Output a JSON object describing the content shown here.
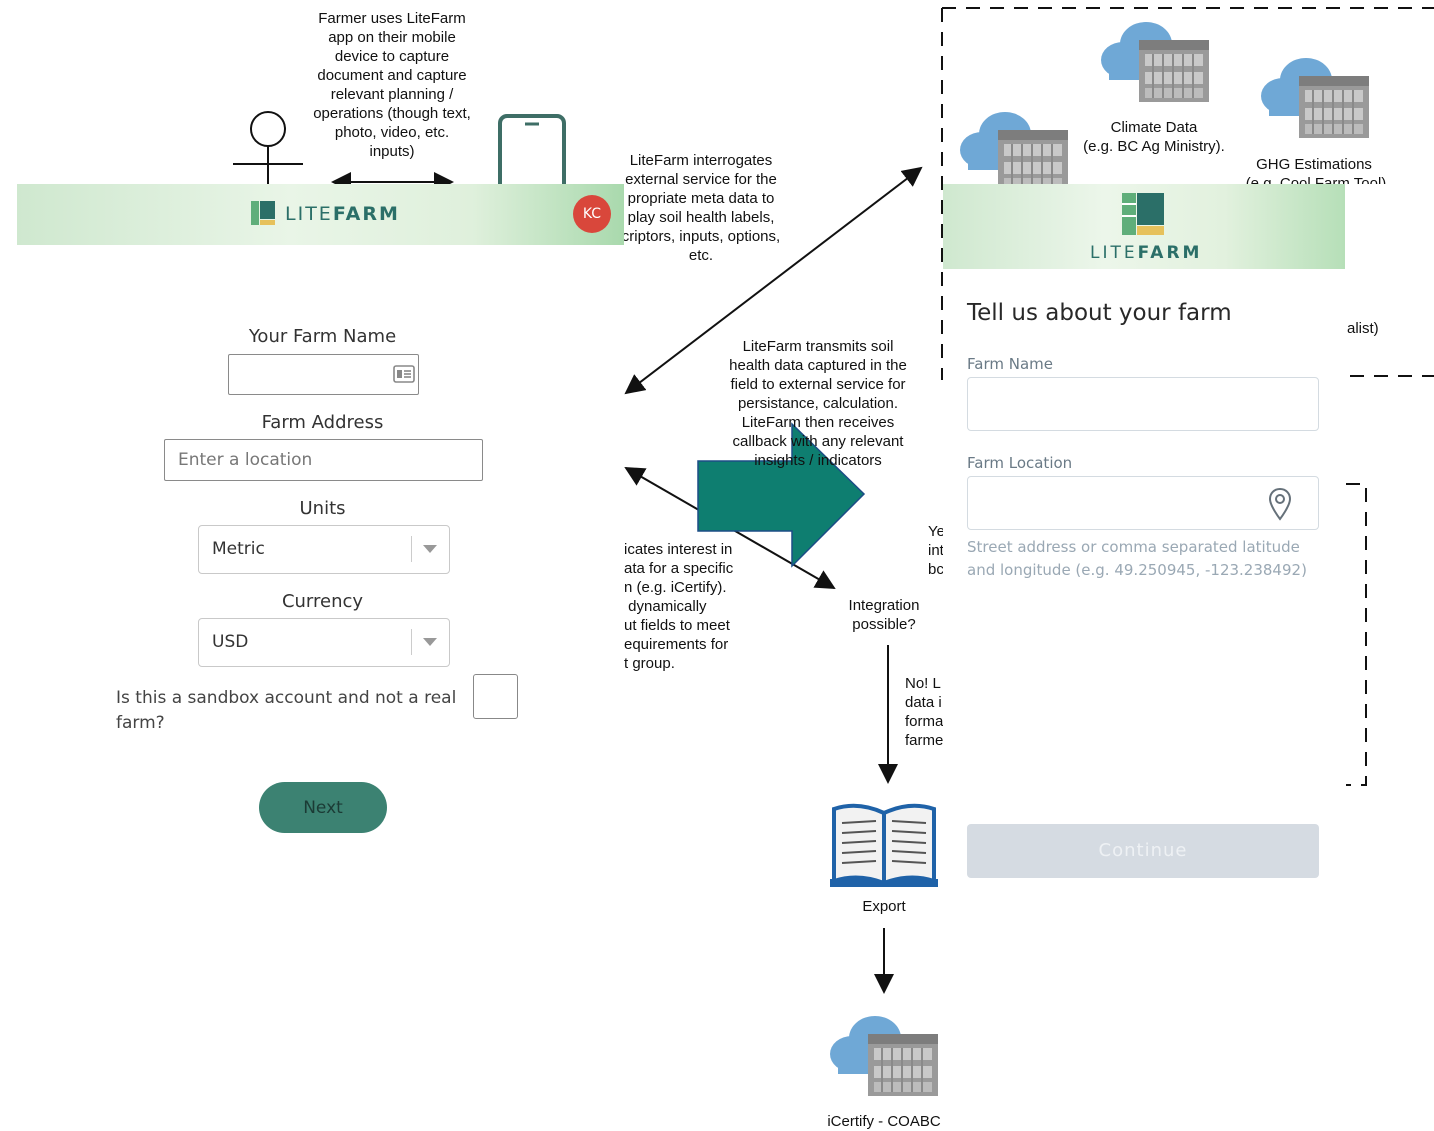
{
  "diagram": {
    "farmer_uses": "Farmer uses LiteFarm\napp on their mobile\ndevice to capture\ndocument and capture\nrelevant planning /\noperations (though text,\nphoto, video, etc.\ninputs)",
    "interrogates": "LiteFarm interrogates\nexternal service for the\npropriate meta data to\nplay soil health labels,\ncriptors, inputs, options,\netc.",
    "transmits": "LiteFarm transmits soil\nhealth data captured in the\nfield to external service for\npersistance, calculation.\nLiteFarm then receives\ncallback with any relevant\ninsights / indicators",
    "indicates": "icates interest in\nata for a specific\nn (e.g. iCertify).\n dynamically\nut fields to meet\nequirements for\nt group.",
    "integration": "Integration\npossible?",
    "yes_partial": "Ye\nint\nbc",
    "no_partial": "No! L\ndata i\nforma\nfarme",
    "climate_data": "Climate Data\n(e.g. BC Ag Ministry).",
    "ghg": "GHG Estimations",
    "ghg_sub": "(e.g. Cool Farm Tool)",
    "alist": "alist)",
    "export": "Export",
    "icertify": "iCertify - COABC"
  },
  "app_left": {
    "brand_lite": "LITE",
    "brand_farm": "FARM",
    "avatar_initials": "KC",
    "farm_name_label": "Your Farm Name",
    "farm_address_label": "Farm Address",
    "farm_address_placeholder": "Enter a location",
    "units_label": "Units",
    "units_value": "Metric",
    "currency_label": "Currency",
    "currency_value": "USD",
    "sandbox_question": "Is this a sandbox account and not a real farm?",
    "next_button": "Next",
    "colors": {
      "accent": "#3c8272",
      "avatar": "#d9473b"
    }
  },
  "app_right": {
    "brand_lite": "LITE",
    "brand_farm": "FARM",
    "title": "Tell us about your farm",
    "farm_name_label": "Farm Name",
    "farm_location_label": "Farm Location",
    "location_hint": "Street address or comma separated latitude and longitude (e.g. 49.250945, -123.238492)",
    "continue_button": "Continue",
    "colors": {
      "label": "#6a7a86",
      "hint": "#9aa8b4",
      "disabled_button": "#d5dbe2"
    }
  }
}
